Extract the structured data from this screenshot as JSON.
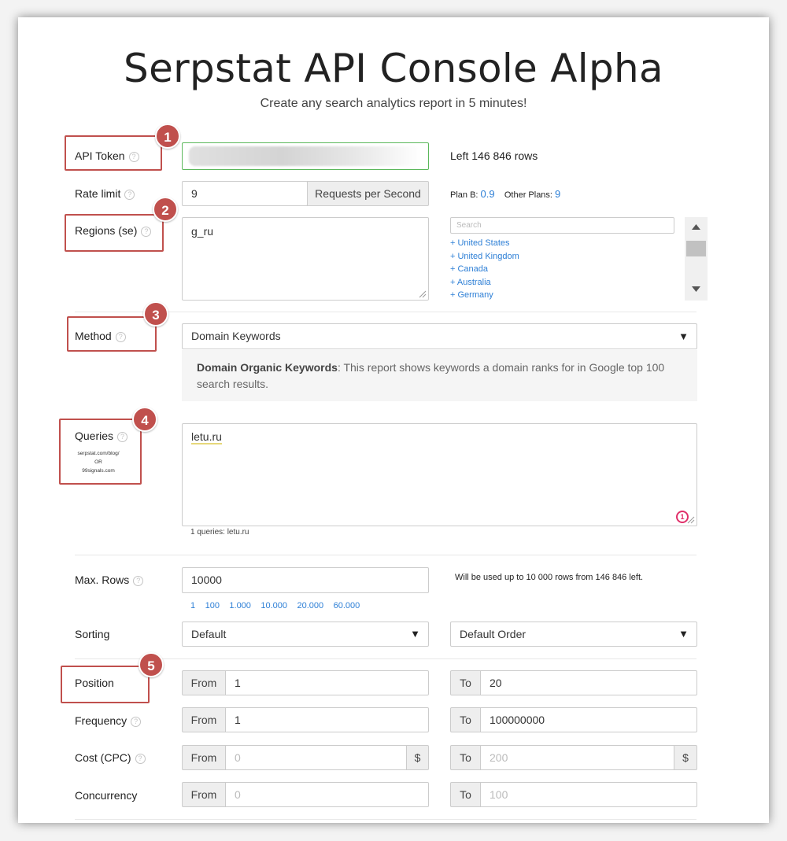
{
  "title": "Serpstat API Console Alpha",
  "subtitle": "Create any search analytics report in 5 minutes!",
  "badges": [
    "1",
    "2",
    "3",
    "4",
    "5"
  ],
  "colors": {
    "accent": "#c0504d",
    "link": "#2d7fd6",
    "token_border": "#5cb85c"
  },
  "api_token": {
    "label": "API Token",
    "left_rows": "Left 146 846 rows"
  },
  "rate_limit": {
    "label": "Rate limit",
    "value": "9",
    "unit": "Requests per Second",
    "plan_b_label": "Plan B:",
    "plan_b_value": "0.9",
    "other_label": "Other Plans:",
    "other_value": "9"
  },
  "regions": {
    "label": "Regions (se)",
    "value": "g_ru",
    "search_placeholder": "Search",
    "items": [
      "+ United States",
      "+ United Kingdom",
      "+ Canada",
      "+ Australia",
      "+ Germany"
    ]
  },
  "method": {
    "label": "Method",
    "selected": "Domain Keywords",
    "desc_bold": "Domain Organic Keywords",
    "desc_line1": ": This report shows keywords a domain ranks for in Google top 100",
    "desc_line2": "search results."
  },
  "queries": {
    "label": "Queries",
    "hint1": "serpstat.com/blog/",
    "hint2": "OR",
    "hint3": "99signals.com",
    "value": "letu.ru",
    "counter": "1",
    "summary": "1 queries: letu.ru"
  },
  "max_rows": {
    "label": "Max. Rows",
    "value": "10000",
    "note": "Will be used up to 10 000 rows from 146 846 left.",
    "options": [
      "1",
      "100",
      "1.000",
      "10.000",
      "20.000",
      "60.000"
    ]
  },
  "sorting": {
    "label": "Sorting",
    "field": "Default",
    "order": "Default Order"
  },
  "filters": {
    "from_label": "From",
    "to_label": "To",
    "currency": "$",
    "position": {
      "label": "Position",
      "from": "1",
      "to": "20"
    },
    "frequency": {
      "label": "Frequency",
      "from": "1",
      "to": "100000000"
    },
    "cost": {
      "label": "Cost (CPC)",
      "from": "0",
      "to": "200"
    },
    "concurrency": {
      "label": "Concurrency",
      "from": "0",
      "to": "100"
    }
  }
}
